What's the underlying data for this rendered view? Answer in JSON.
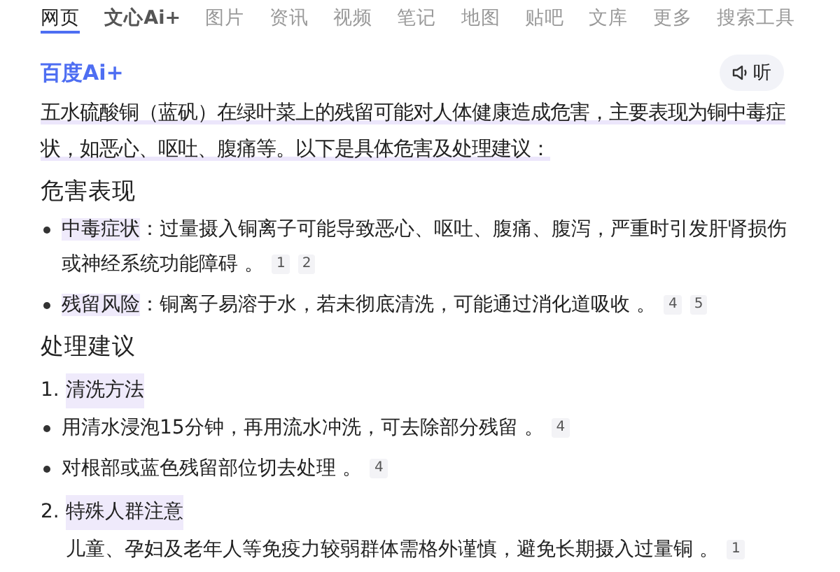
{
  "tabs": [
    {
      "label": "网页",
      "kind": "plain",
      "selected": true
    },
    {
      "label": "文心Ai+",
      "kind": "brand",
      "selected": false
    },
    {
      "label": "图片",
      "kind": "plain",
      "selected": false
    },
    {
      "label": "资讯",
      "kind": "plain",
      "selected": false
    },
    {
      "label": "视频",
      "kind": "plain",
      "selected": false
    },
    {
      "label": "笔记",
      "kind": "plain",
      "selected": false
    },
    {
      "label": "地图",
      "kind": "plain",
      "selected": false
    },
    {
      "label": "贴吧",
      "kind": "plain",
      "selected": false
    },
    {
      "label": "文库",
      "kind": "plain",
      "selected": false
    },
    {
      "label": "更多",
      "kind": "plain",
      "selected": false
    },
    {
      "label": "搜索工具",
      "kind": "plain",
      "selected": false
    }
  ],
  "answer": {
    "logo": "百度Ai+",
    "listen_button": "听",
    "summary": "五水硫酸铜（蓝矾）在绿叶菜上的残留可能对人体健康造成危害，主要表现为铜中毒症状，如恶心、呕吐、腹痛等。以下是具体危害及处理建议：",
    "sections": [
      {
        "heading": "危害表现",
        "blocks": [
          {
            "kind": "bullet",
            "term": "中毒症状",
            "text": "：过量摄入铜离子可能导致恶心、呕吐、腹痛、腹泻，严重时引发肝肾损伤或神经系统功能障碍 。",
            "citations": [
              "1",
              "2"
            ]
          },
          {
            "kind": "bullet",
            "term": "残留风险",
            "text": "：铜离子易溶于水，若未彻底清洗，可能通过消化道吸收 。",
            "citations": [
              "4",
              "5"
            ]
          }
        ]
      },
      {
        "heading": "处理建议",
        "blocks": [
          {
            "kind": "numbered",
            "number": "1.",
            "term": "清洗方法"
          },
          {
            "kind": "bullet",
            "text": "用清水浸泡15分钟，再用流水冲洗，可去除部分残留 。",
            "citations": [
              "4"
            ]
          },
          {
            "kind": "bullet",
            "text": "对根部或蓝色残留部位切去处理 。",
            "citations": [
              "4"
            ]
          },
          {
            "kind": "numbered",
            "number": "2.",
            "term": "特殊人群注意"
          },
          {
            "kind": "plain",
            "text": "儿童、孕妇及老年人等免疫力较弱群体需格外谨慎，避免长期摄入过量铜 。",
            "citations": [
              "1"
            ]
          }
        ]
      }
    ]
  }
}
